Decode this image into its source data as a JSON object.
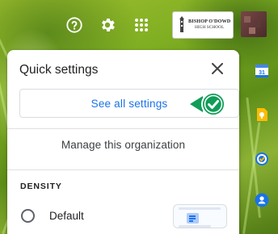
{
  "topbar": {
    "help_icon": "help-circle-icon",
    "settings_icon": "gear-icon",
    "apps_icon": "apps-grid-icon",
    "org_logo": {
      "line1": "BISHOP O'DOWD",
      "line2": "HIGH SCHOOL"
    },
    "avatar": "user-avatar"
  },
  "side_panel": {
    "icons": [
      "calendar-icon",
      "keep-icon",
      "tasks-icon",
      "contacts-icon"
    ],
    "calendar_number": "31"
  },
  "quick_settings": {
    "title": "Quick settings",
    "close_icon": "close-icon",
    "see_all_label": "See all settings",
    "manage_label": "Manage this organization",
    "density": {
      "section_title": "DENSITY",
      "options": [
        {
          "label": "Default",
          "selected": false
        }
      ]
    }
  },
  "colors": {
    "accent_blue": "#1a73e8",
    "check_green": "#0f9d58",
    "panel_bg": "#ffffff"
  }
}
